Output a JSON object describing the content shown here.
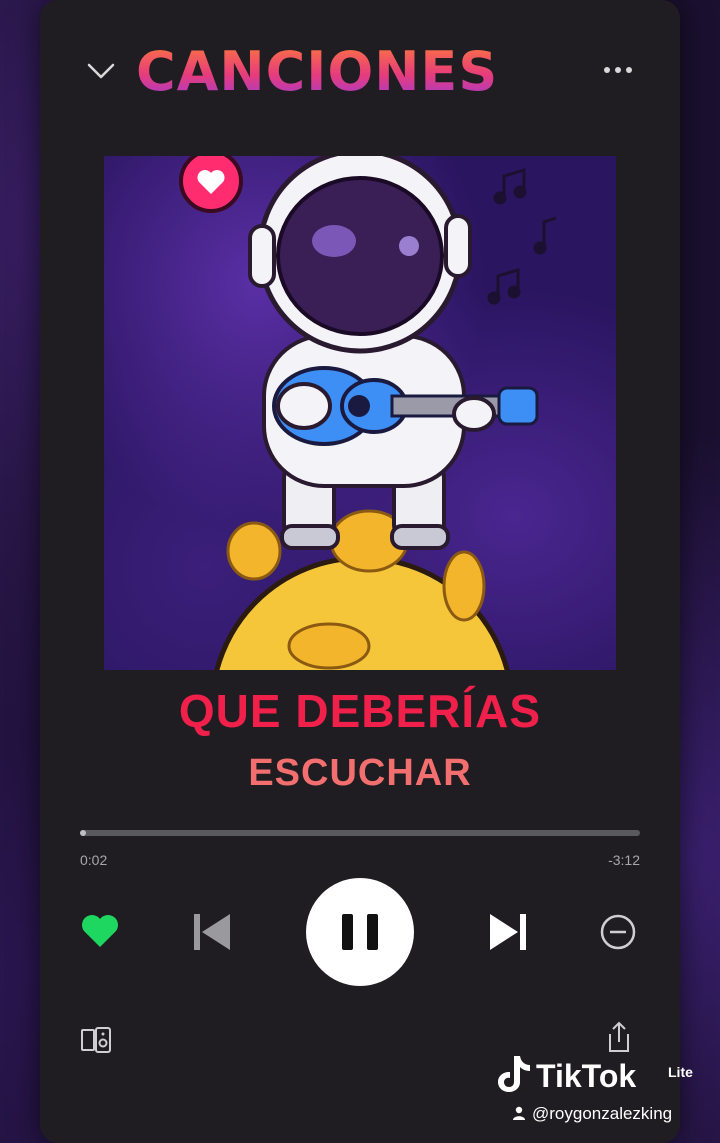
{
  "header": {
    "title": "CANCIONES"
  },
  "subtitle": {
    "line1": "QUE DEBERÍAS",
    "line2": "ESCUCHAR"
  },
  "player": {
    "elapsed": "0:02",
    "remaining": "-3:12",
    "progress_fraction": 0.01,
    "liked": true,
    "state": "playing"
  },
  "colors": {
    "heart_green": "#1ed760",
    "subtitle_red": "#f0204a",
    "subtitle_salmon": "#f36f6f"
  },
  "watermark": {
    "brand": "TikTok",
    "tier": "Lite",
    "username": "@roygonzalezking"
  }
}
